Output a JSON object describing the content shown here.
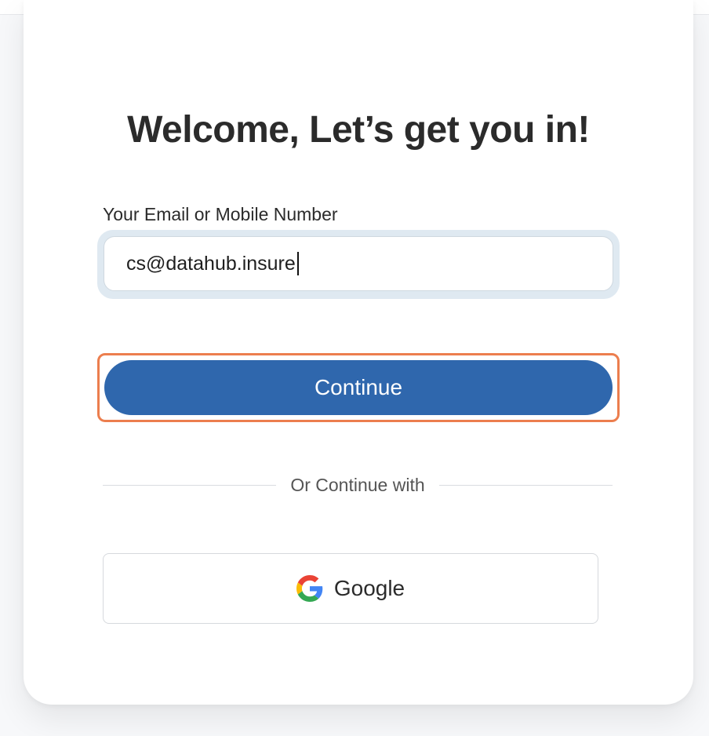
{
  "heading": "Welcome, Let’s get you in!",
  "email_field": {
    "label": "Your Email or Mobile Number",
    "value": "cs@datahub.insure"
  },
  "continue_button": {
    "label": "Continue"
  },
  "divider": {
    "text": "Or Continue with"
  },
  "google_button": {
    "label": "Google",
    "icon": "google-icon"
  },
  "colors": {
    "primary": "#2f67ad",
    "focus_outline": "#ec7e4e",
    "input_ring": "#dfe9f1",
    "text": "#2b2b2b"
  }
}
